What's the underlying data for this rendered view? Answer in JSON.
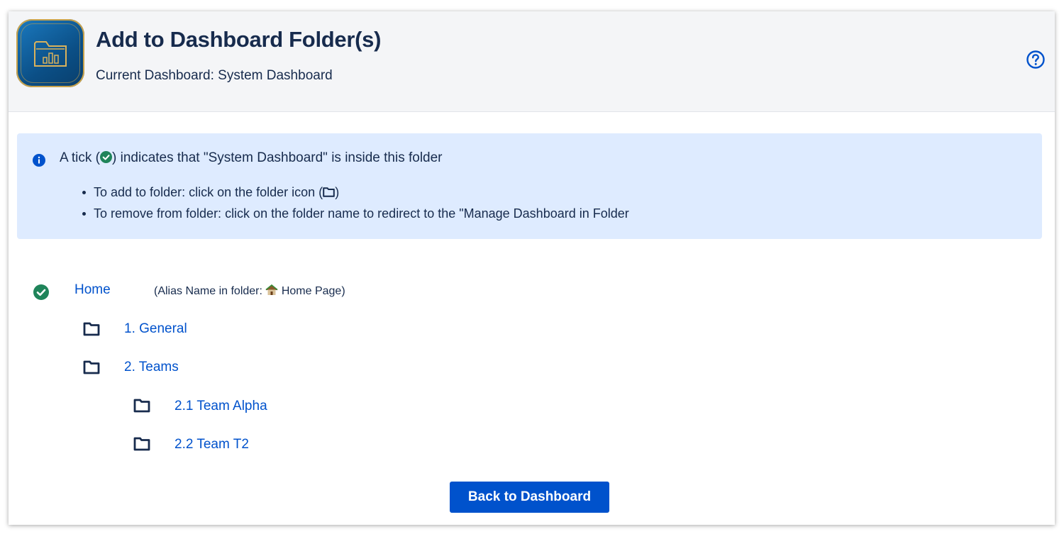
{
  "header": {
    "title": "Add to Dashboard Folder(s)",
    "subtitle": "Current Dashboard: System Dashboard",
    "logo_icon": "dashboard-folder-logo-icon",
    "help_icon": "question-circle-icon"
  },
  "info": {
    "title_prefix": "A tick (",
    "title_suffix": ") indicates that \"System Dashboard\" is inside this folder",
    "items": [
      {
        "prefix": "To add to folder: click on the folder icon (",
        "suffix": ")"
      },
      {
        "text": "To remove from folder: click on the folder name to redirect to the \"Manage Dashboard in Folder"
      }
    ]
  },
  "folders": [
    {
      "name": "Home",
      "status": "included",
      "alias_label": "(Alias Name in folder: ",
      "alias_icon": "house-icon",
      "alias_value": " Home Page)"
    },
    {
      "name": "1. General",
      "status": "not-included"
    },
    {
      "name": "2. Teams",
      "status": "not-included"
    },
    {
      "name": "2.1 Team Alpha",
      "status": "not-included"
    },
    {
      "name": "2.2 Team T2",
      "status": "not-included"
    }
  ],
  "actions": {
    "back_label": "Back to Dashboard"
  },
  "colors": {
    "header_bg": "#f4f5f7",
    "info_bg": "#deebff",
    "link": "#0052cc",
    "tick": "#1f845a",
    "button_bg": "#0052cc",
    "text": "#172b4d"
  }
}
